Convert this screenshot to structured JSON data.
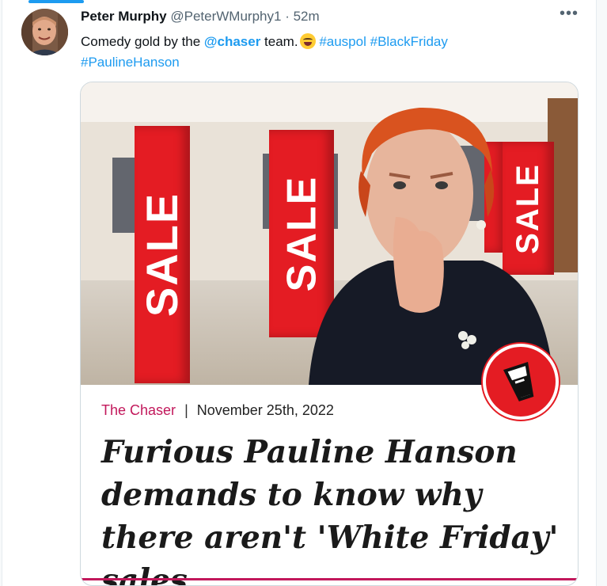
{
  "tweet": {
    "author": "Peter Murphy",
    "handle": "@PeterWMurphy1",
    "separator": "·",
    "time": "52m",
    "more_label": "•••",
    "text_prefix": "Comedy gold by the ",
    "mention": "@chaser",
    "text_suffix": " team.",
    "emoji_icon": "face-with-tears-of-joy-icon",
    "hashtags": [
      "#auspol",
      "#BlackFriday",
      "#PaulineHanson"
    ]
  },
  "card": {
    "sale_signs": [
      "SALE",
      "SALE",
      "SALE"
    ],
    "publisher": "The Chaser",
    "divider": "|",
    "date": "November 25th, 2022",
    "headline": "Furious Pauline Hanson demands to know why there aren't 'White Friday' sales",
    "badge_icon": "chaser-cup-logo-icon",
    "accent_color": "#c2185b",
    "sale_color": "#e41c23"
  },
  "colors": {
    "link": "#1d9bf0",
    "text": "#0f1419",
    "muted": "#536471"
  }
}
